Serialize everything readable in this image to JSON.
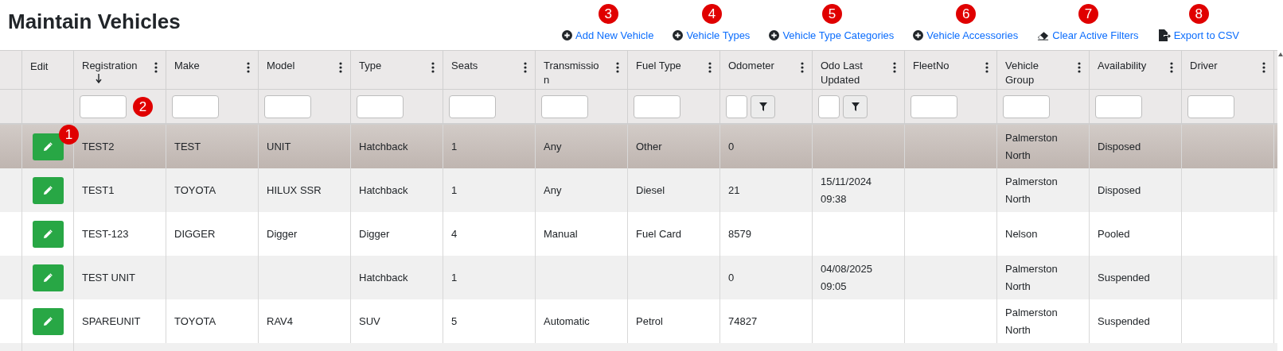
{
  "page": {
    "title": "Maintain Vehicles"
  },
  "actions": [
    {
      "kind": "add",
      "label": "Add New Vehicle",
      "badge": "3"
    },
    {
      "kind": "add",
      "label": "Vehicle Types",
      "badge": "4"
    },
    {
      "kind": "add",
      "label": "Vehicle Type Categories",
      "badge": "5"
    },
    {
      "kind": "add",
      "label": "Vehicle Accessories",
      "badge": "6"
    },
    {
      "kind": "eraser",
      "label": "Clear Active Filters",
      "badge": "7"
    },
    {
      "kind": "export",
      "label": "Export to CSV",
      "badge": "8"
    }
  ],
  "table": {
    "edit_column": {
      "label": "Edit"
    },
    "columns": [
      {
        "label": "Registration",
        "kind": "text",
        "sorted": true,
        "badge": "2"
      },
      {
        "label": "Make",
        "kind": "text",
        "sorted": false
      },
      {
        "label": "Model",
        "kind": "text",
        "sorted": false
      },
      {
        "label": "Type",
        "kind": "text",
        "sorted": false
      },
      {
        "label": "Seats",
        "kind": "text",
        "sorted": false
      },
      {
        "label": "Transmission",
        "kind": "text",
        "sorted": false
      },
      {
        "label": "Fuel Type",
        "kind": "text",
        "sorted": false
      },
      {
        "label": "Odometer",
        "kind": "numeric",
        "sorted": false
      },
      {
        "label": "Odo Last Updated",
        "kind": "numeric",
        "sorted": false
      },
      {
        "label": "FleetNo",
        "kind": "text",
        "sorted": false
      },
      {
        "label": "Vehicle Group",
        "kind": "text",
        "sorted": false
      },
      {
        "label": "Availability",
        "kind": "text",
        "sorted": false
      },
      {
        "label": "Driver",
        "kind": "text",
        "sorted": false
      }
    ],
    "rows": [
      {
        "selected": true,
        "edit_badge": "1",
        "cells": [
          "TEST2",
          "TEST",
          "UNIT",
          "Hatchback",
          "1",
          "Any",
          "Other",
          "0",
          null,
          null,
          "Palmerston North",
          "Disposed",
          null
        ]
      },
      {
        "selected": false,
        "cells": [
          "TEST1",
          "TOYOTA",
          "HILUX SSR",
          "Hatchback",
          "1",
          "Any",
          "Diesel",
          "21",
          "15/11/2024 09:38",
          null,
          "Palmerston North",
          "Disposed",
          null
        ]
      },
      {
        "selected": false,
        "cells": [
          "TEST-123",
          "DIGGER",
          "Digger",
          "Digger",
          "4",
          "Manual",
          "Fuel Card",
          "8579",
          null,
          null,
          "Nelson",
          "Pooled",
          null
        ]
      },
      {
        "selected": false,
        "cells": [
          "TEST UNIT",
          null,
          null,
          "Hatchback",
          "1",
          null,
          null,
          "0",
          "04/08/2025 09:05",
          null,
          "Palmerston North",
          "Suspended",
          null
        ]
      },
      {
        "selected": false,
        "cells": [
          "SPAREUNIT",
          "TOYOTA",
          "RAV4",
          "SUV",
          "5",
          "Automatic",
          "Petrol",
          "74827",
          null,
          null,
          "Palmerston North",
          "Suspended",
          null
        ]
      }
    ]
  }
}
